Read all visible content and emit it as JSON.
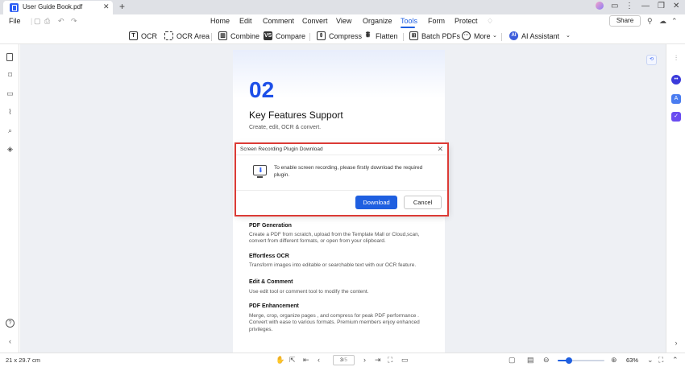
{
  "window": {
    "tab_title": "User Guide Book.pdf",
    "close_tab": "✕",
    "add_tab": "+",
    "window_controls": [
      "⋮",
      "—",
      "❐",
      "✕"
    ]
  },
  "menubar": {
    "file": "File",
    "items": [
      "Home",
      "Edit",
      "Comment",
      "Convert",
      "View",
      "Organize",
      "Tools",
      "Form",
      "Protect"
    ],
    "active": "Tools",
    "share": "Share"
  },
  "toolbar": {
    "ocr": "OCR",
    "ocr_area": "OCR Area",
    "combine": "Combine",
    "compare": "Compare",
    "compress": "Compress",
    "flatten": "Flatten",
    "batch_pdfs": "Batch PDFs",
    "more": "More",
    "ai_assistant": "AI Assistant",
    "ai_badge": "AI"
  },
  "document": {
    "number": "02",
    "title": "Key Features Support",
    "subtitle": "Create, edit, OCR & convert.",
    "sections": [
      {
        "heading": "PDF Generation",
        "text": "Create a PDF from scratch, upload from the Template Mall or Cloud,scan, convert from different formats, or open from your clipboard."
      },
      {
        "heading": "Effortless OCR",
        "text": "Transform images into editable or searchable text with our OCR feature."
      },
      {
        "heading": "Edit & Comment",
        "text": "Use edit tool or comment tool to modify the content."
      },
      {
        "heading": "PDF Enhancement",
        "text": "Merge, crop, organize pages , and compress for peak PDF performance . Convert with ease to various formats. Premium members enjoy enhanced privileges."
      }
    ]
  },
  "dialog": {
    "title": "Screen Recording Plugin Download",
    "message": "To enable screen recording, please firstly download the required plugin.",
    "download": "Download",
    "cancel": "Cancel",
    "close": "✕"
  },
  "statusbar": {
    "page_size": "21 x 29.7 cm",
    "current_page": "3",
    "total_pages": "/5",
    "zoom": "63%",
    "zoom_fraction": 0.24
  },
  "colors": {
    "accent": "#1f5fe0",
    "highlight": "#dc3b36",
    "doc_number": "#1d4fe8"
  }
}
